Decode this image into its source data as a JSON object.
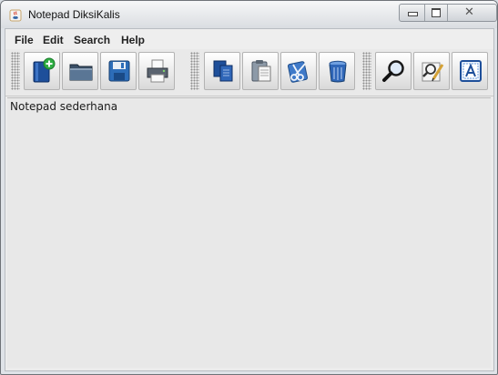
{
  "window": {
    "title": "Notepad DiksiKalis"
  },
  "menu": {
    "items": [
      "File",
      "Edit",
      "Search",
      "Help"
    ]
  },
  "toolbar": {
    "groups": [
      [
        "new-file-icon",
        "open-folder-icon",
        "save-icon",
        "print-icon"
      ],
      [
        "copy-icon",
        "paste-icon",
        "cut-icon",
        "delete-icon"
      ],
      [
        "search-icon",
        "replace-icon",
        "font-icon"
      ]
    ]
  },
  "editor": {
    "text": "Notepad sederhana"
  },
  "colors": {
    "accent_blue": "#1e4f9a",
    "toolbar_bg": "#e9e9e9",
    "text_area_bg": "#e8e8e8",
    "new_icon_badge": "#2fae43"
  }
}
